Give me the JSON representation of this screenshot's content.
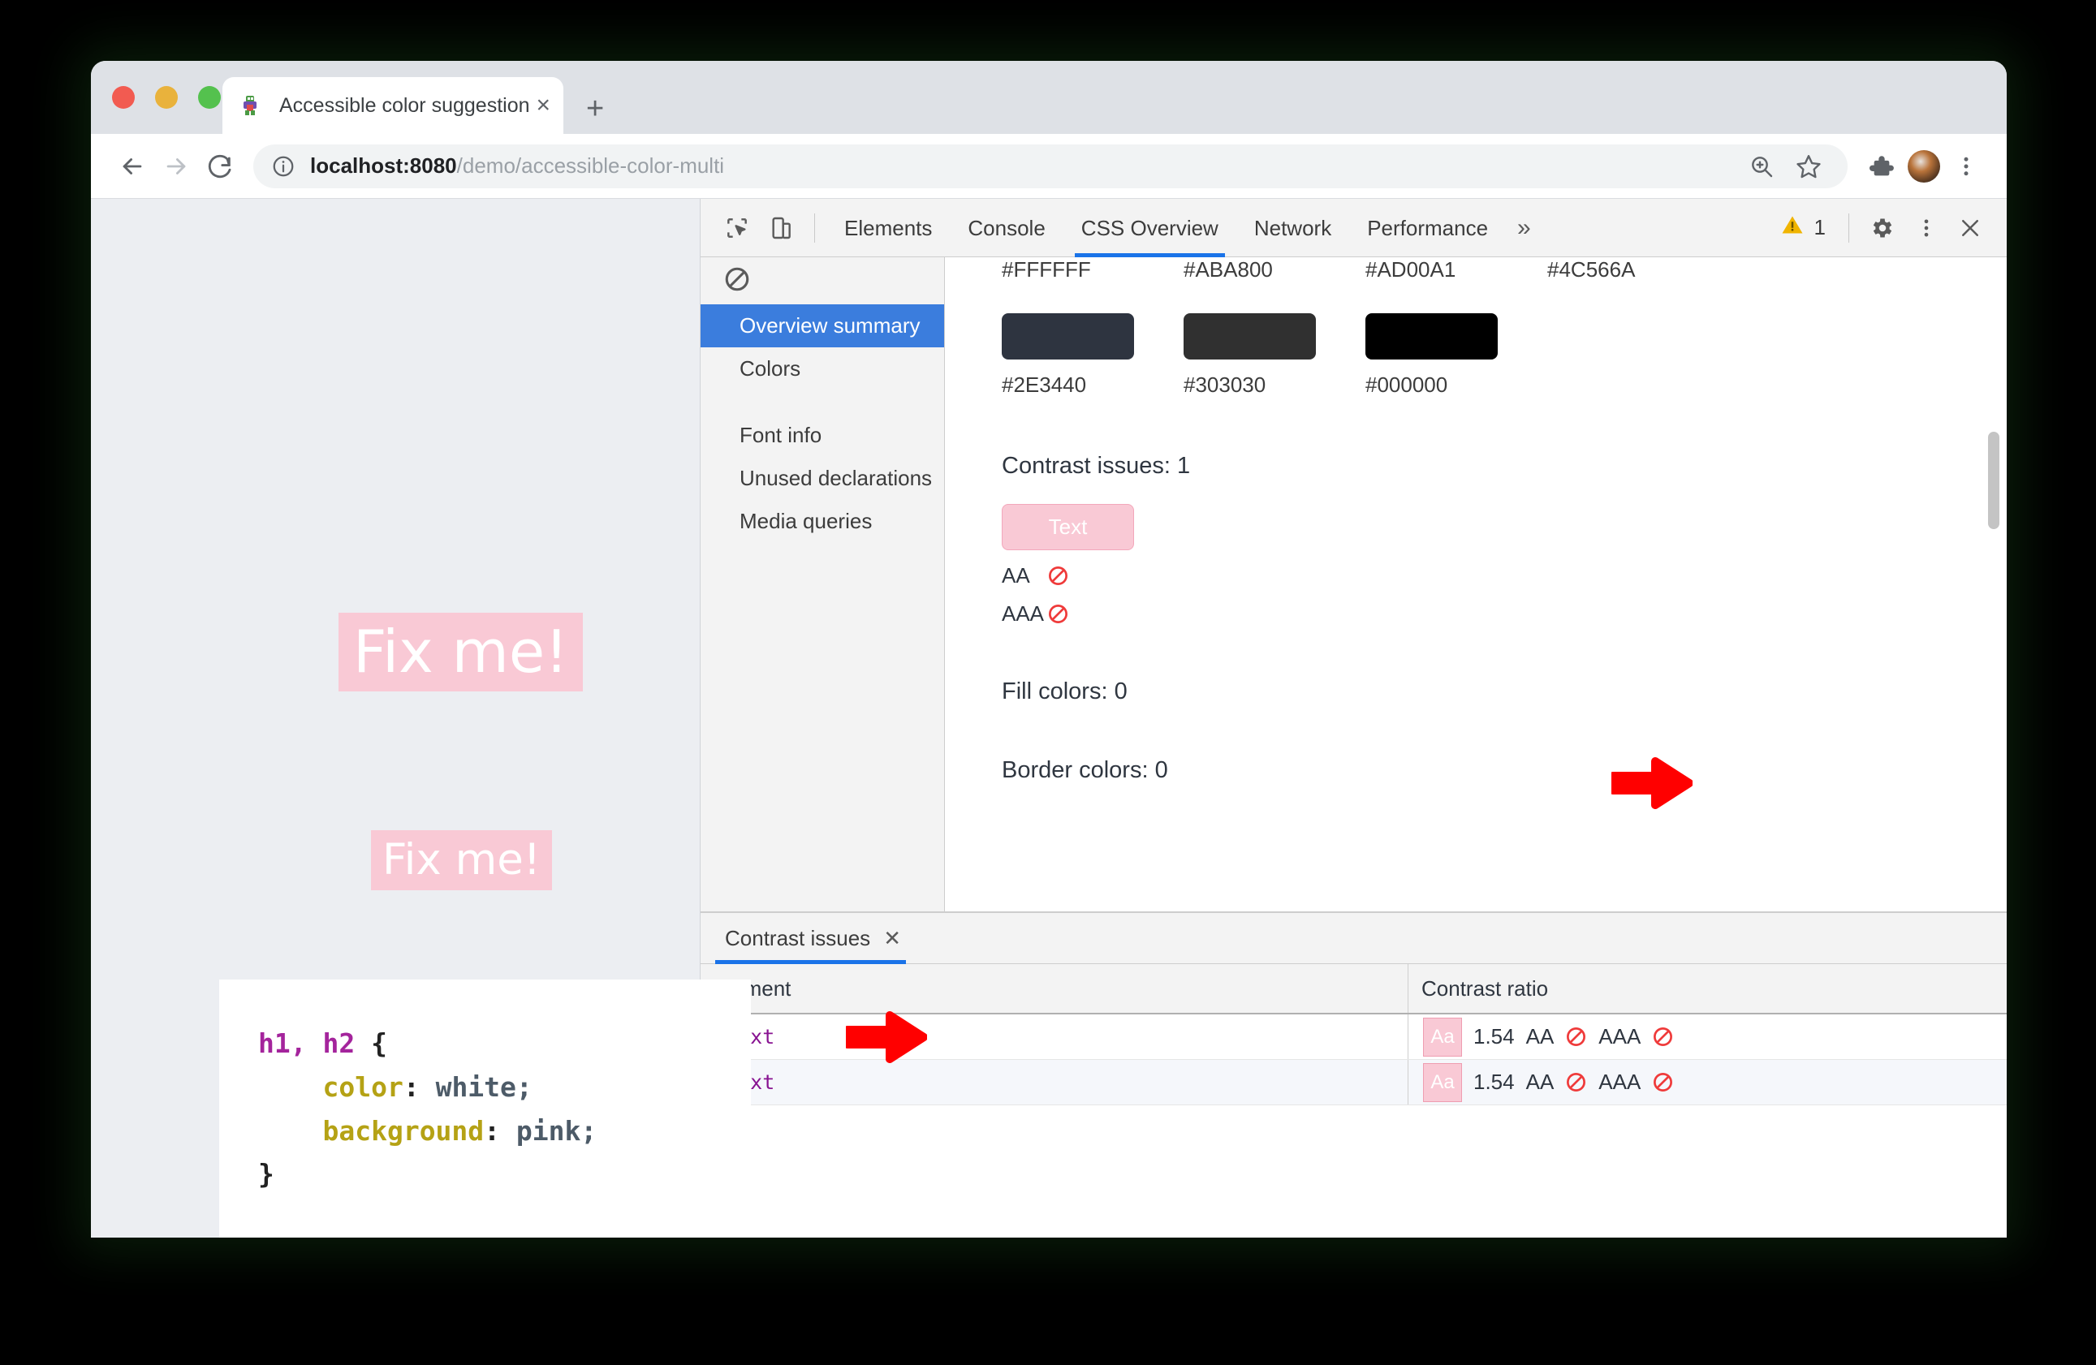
{
  "browser": {
    "tab": {
      "title": "Accessible color suggestion",
      "close_label": "×",
      "favicon_name": "site-favicon"
    },
    "new_tab_label": "+",
    "nav": {
      "back_label": "←",
      "forward_label": "→",
      "reload_label": "⟳"
    },
    "omnibox": {
      "url_host": "localhost:8080",
      "url_path": "/demo/accessible-color-multi",
      "url_full": "localhost:8080/demo/accessible-color-multi"
    },
    "toolbar_icons": [
      "zoom-icon",
      "bookmark-star-icon",
      "extensions-puzzle-icon",
      "profile-avatar",
      "chrome-menu-icon"
    ]
  },
  "page": {
    "h1_text": "Fix me!",
    "h2_text": "Fix me!",
    "code": {
      "selector": "h1, h2",
      "open_brace": " {",
      "prop1": "color",
      "val1": " white;",
      "prop2": "background",
      "val2": " pink;",
      "close_brace": "}",
      "colon": ":"
    }
  },
  "devtools": {
    "toolbar": {
      "inspect_icon": "inspect-element-icon",
      "device_icon": "device-toolbar-icon",
      "tabs": [
        {
          "label": "Elements",
          "active": false
        },
        {
          "label": "Console",
          "active": false
        },
        {
          "label": "CSS Overview",
          "active": true
        },
        {
          "label": "Network",
          "active": false
        },
        {
          "label": "Performance",
          "active": false
        }
      ],
      "more_tabs_label": "»",
      "warning_count": "1",
      "warning_icon": "warning-triangle-icon",
      "settings_icon": "gear-icon",
      "menu_icon": "vertical-dots-icon",
      "close_icon": "close-icon"
    },
    "overview_sidebar": {
      "block_icon": "no-entry-icon",
      "items": [
        {
          "label": "Overview summary",
          "active": true
        },
        {
          "label": "Colors",
          "active": false
        },
        {
          "label": "Font info",
          "active": false
        },
        {
          "label": "Unused declarations",
          "active": false
        },
        {
          "label": "Media queries",
          "active": false
        }
      ]
    },
    "overview_main": {
      "top_hex_labels": [
        "#FFFFFF",
        "#ABA800",
        "#AD00A1",
        "#4C566A"
      ],
      "swatches": [
        {
          "hex": "#2E3440",
          "label": "#2E3440"
        },
        {
          "hex": "#303030",
          "label": "#303030"
        },
        {
          "hex": "#000000",
          "label": "#000000"
        }
      ],
      "contrast_issues_label": "Contrast issues: 1",
      "text_chip_label": "Text",
      "aa_label": "AA",
      "aaa_label": "AAA",
      "fail_icon": "no-entry-icon",
      "fill_colors_label": "Fill colors: 0",
      "border_colors_label": "Border colors: 0"
    },
    "drawer": {
      "tab_label": "Contrast issues",
      "tab_close_label": "✕",
      "table": {
        "columns": [
          "Element",
          "Contrast ratio"
        ],
        "rows": [
          {
            "element": "#text",
            "chip": "Aa",
            "ratio": "1.54",
            "aa": "AA",
            "aa_pass": false,
            "aaa": "AAA",
            "aaa_pass": false
          },
          {
            "element": "#text",
            "chip": "Aa",
            "ratio": "1.54",
            "aa": "AA",
            "aa_pass": false,
            "aaa": "AAA",
            "aaa_pass": false
          }
        ]
      }
    }
  },
  "annotations": {
    "arrow1_name": "arrow-pointing-to-text-chip",
    "arrow2_name": "arrow-pointing-to-contrast-table"
  },
  "colors": {
    "accent_blue": "#1a73e8",
    "sidebar_selected": "#3b7ddd",
    "pink_bg": "#f9c9d5",
    "fail_red": "#ef3a3a",
    "annotation_red": "#ff0000",
    "code_selector": "#a4249c",
    "code_property": "#b5a215"
  }
}
